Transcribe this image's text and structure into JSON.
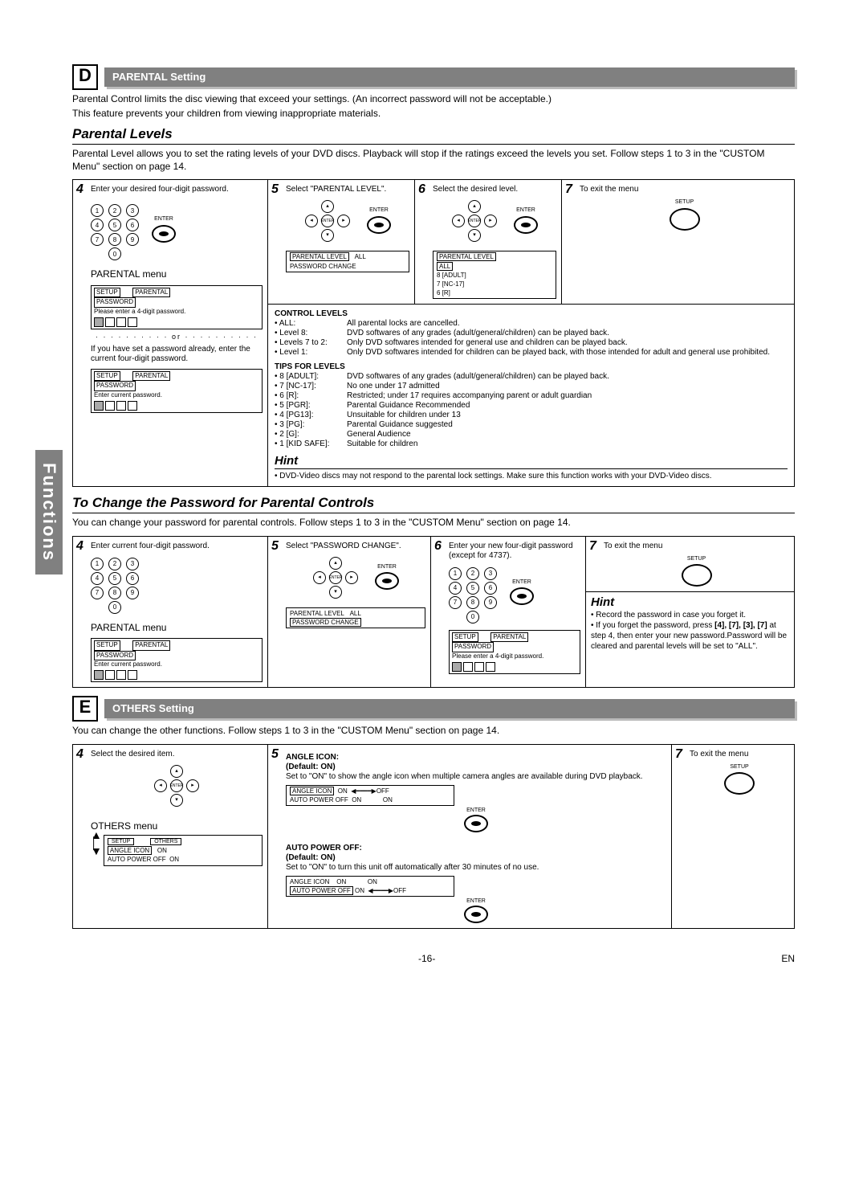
{
  "sideTab": "Functions",
  "sectionD": {
    "letter": "D",
    "title": "PARENTAL Setting",
    "intro1": "Parental Control limits the disc viewing that exceed your settings. (An incorrect password will not be acceptable.)",
    "intro2": "This feature prevents your children from viewing inappropriate materials."
  },
  "parentalLevels": {
    "heading": "Parental Levels",
    "desc": "Parental Level allows you to set the rating levels of your DVD discs. Playback will stop if the ratings exceed the levels you set. Follow steps 1 to 3 in the \"CUSTOM Menu\" section on page 14."
  },
  "steps1": {
    "s4": {
      "num": "4",
      "text": "Enter your desired four-digit password.",
      "enter": "ENTER",
      "menuTitle": "PARENTAL menu",
      "osdNew": {
        "top1": "SETUP",
        "top2": "PARENTAL",
        "line1": "PASSWORD",
        "line2": "Please enter a 4-digit password."
      },
      "orSep": "or",
      "orText": "If you have set a password already, enter the current four-digit password.",
      "osdCur": {
        "top1": "SETUP",
        "top2": "PARENTAL",
        "line1": "PASSWORD",
        "line2": "Enter current password."
      }
    },
    "s5": {
      "num": "5",
      "text": "Select \"PARENTAL LEVEL\".",
      "enterLabel": "ENTER",
      "osd": {
        "l1": "PARENTAL LEVEL",
        "r1": "ALL",
        "l2": "PASSWORD CHANGE"
      },
      "controlLevelsTitle": "CONTROL LEVELS",
      "controlLevels": [
        {
          "k": "• ALL:",
          "v": "All parental locks are cancelled."
        },
        {
          "k": "• Level 8:",
          "v": "DVD softwares of any grades (adult/general/children) can be played back."
        },
        {
          "k": "• Levels 7 to 2:",
          "v": "Only DVD softwares intended for general use and children can be played back."
        },
        {
          "k": "• Level 1:",
          "v": "Only DVD softwares intended for children can be played back, with those intended for adult and general use prohibited."
        }
      ],
      "tipsTitle": "TIPS FOR LEVELS",
      "tips": [
        {
          "k": "• 8 [ADULT]:",
          "v": "DVD softwares of any grades (adult/general/children) can be played back."
        },
        {
          "k": "• 7 [NC-17]:",
          "v": "No one under 17 admitted"
        },
        {
          "k": "• 6 [R]:",
          "v": "Restricted; under 17 requires accompanying parent or adult guardian"
        },
        {
          "k": "• 5 [PGR]:",
          "v": "Parental Guidance Recommended"
        },
        {
          "k": "• 4 [PG13]:",
          "v": "Unsuitable for children under 13"
        },
        {
          "k": "• 3 [PG]:",
          "v": "Parental Guidance suggested"
        },
        {
          "k": "• 2 [G]:",
          "v": "General Audience"
        },
        {
          "k": "• 1 [KID SAFE]:",
          "v": "Suitable for children"
        }
      ]
    },
    "s6": {
      "num": "6",
      "text": "Select the desired level.",
      "enter": "ENTER",
      "osd": {
        "l1": "PARENTAL LEVEL",
        "opts": [
          "ALL",
          "8 [ADULT]",
          "7 [NC-17]",
          "6 [R]"
        ]
      }
    },
    "s7": {
      "num": "7",
      "text": "To exit the menu",
      "setup": "SETUP"
    },
    "hintTitle": "Hint",
    "hintBody": "• DVD-Video discs may not respond to the parental lock settings. Make sure this function works with your DVD-Video discs."
  },
  "changePw": {
    "heading": "To Change the Password for Parental Controls",
    "desc": "You can change your password for parental controls.  Follow steps 1 to 3 in the \"CUSTOM Menu\" section on page 14.",
    "s4": {
      "num": "4",
      "text": "Enter current four-digit password.",
      "menuTitle": "PARENTAL menu",
      "osd": {
        "top1": "SETUP",
        "top2": "PARENTAL",
        "line1": "PASSWORD",
        "line2": "Enter current password."
      }
    },
    "s5": {
      "num": "5",
      "text": "Select \"PASSWORD CHANGE\".",
      "enter": "ENTER",
      "osd": {
        "l1": "PARENTAL LEVEL",
        "r1": "ALL",
        "l2": "PASSWORD CHANGE"
      }
    },
    "s6": {
      "num": "6",
      "text": "Enter your new four-digit password (except for 4737).",
      "enter": "ENTER",
      "osd": {
        "top1": "SETUP",
        "top2": "PARENTAL",
        "line1": "PASSWORD",
        "line2": "Please enter a 4-digit password."
      }
    },
    "s7": {
      "num": "7",
      "text": "To exit the menu",
      "setup": "SETUP",
      "hintTitle": "Hint",
      "hint1": "• Record the password in case you forget it.",
      "hint2": "• If you forget the password, press [4], [7], [3], [7] at step 4, then enter your new password.Password will be cleared and parental levels will be set to \"ALL\"."
    }
  },
  "sectionE": {
    "letter": "E",
    "title": "OTHERS Setting",
    "desc": "You can change the other functions. Follow steps 1 to 3 in the \"CUSTOM Menu\" section on page 14.",
    "s4": {
      "num": "4",
      "text": "Select the desired item.",
      "enterLabel": "ENTER",
      "menuTitle": "OTHERS menu",
      "osd": {
        "top1": "SETUP",
        "top2": "OTHERS",
        "l1": "ANGLE ICON",
        "r1": "ON",
        "l2": "AUTO POWER OFF",
        "r2": "ON"
      }
    },
    "s5": {
      "num": "5",
      "angle": {
        "title": "ANGLE ICON:",
        "def": "(Default: ON)",
        "body": "Set to \"ON\" to show the angle icon when multiple camera angles are available during DVD playback.",
        "enter": "ENTER",
        "osd": {
          "l1": "ANGLE ICON",
          "r1": "ON",
          "opt1": "OFF",
          "l2": "AUTO POWER OFF",
          "r2": "ON",
          "opt2": "ON"
        }
      },
      "auto": {
        "title": "AUTO POWER OFF:",
        "def": "(Default: ON)",
        "body": "Set to \"ON\" to turn this unit off automatically after 30 minutes of no use.",
        "enter": "ENTER",
        "osd": {
          "l1": "ANGLE ICON",
          "r1": "ON",
          "opt1": "ON",
          "l2": "AUTO POWER OFF",
          "r2": "ON",
          "opt2": "OFF"
        }
      }
    },
    "s7": {
      "num": "7",
      "text": "To exit the menu",
      "setup": "SETUP"
    }
  },
  "footer": {
    "page": "-16-",
    "lang": "EN"
  }
}
